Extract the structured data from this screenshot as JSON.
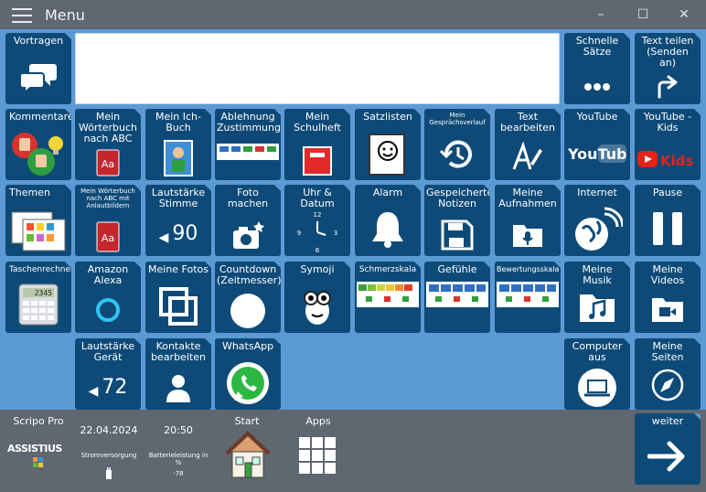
{
  "window": {
    "title": "Menu",
    "minimize": "–",
    "maximize": "☐",
    "close": "✕"
  },
  "top_row": {
    "speak": "Vortragen",
    "quick": "Schnelle\nSätze",
    "share": "Text teilen\n(Senden\nan)"
  },
  "tiles": {
    "comments": "Kommentare",
    "dict_abc": "Mein\nWörterbuch\nnach ABC",
    "my_book": "Mein Ich-\nBuch",
    "reject": "Ablehnung\nZustimmung",
    "notebook": "Mein\nSchulheft",
    "sentences": "Satzlisten",
    "history": "Mein\nGesprächsverlauf",
    "edit_text": "Text\nbearbeiten",
    "youtube": "YouTube",
    "youtube_kids": "YouTube -\nKids",
    "topics": "Themen",
    "dict_pics": "Mein Wörterbuch\nnach ABC mit\nAnlautbildern",
    "voice_vol": "Lautstärke\nStimme",
    "voice_vol_value": "90",
    "photo": "Foto\nmachen",
    "clock": "Uhr &\nDatum",
    "alarm": "Alarm",
    "notes": "Gespeicherte\nNotizen",
    "recordings": "Meine\nAufnahmen",
    "internet": "Internet",
    "pause": "Pause",
    "calculator": "Taschenrechner",
    "alexa": "Amazon\nAlexa",
    "photos": "Meine Fotos",
    "countdown": "Countdown\n(Zeitmesser)",
    "symoji": "Symoji",
    "pain": "Schmerzskala",
    "feelings": "Gefühle",
    "rating": "Bewertungsskala",
    "music": "Meine Musik",
    "videos": "Meine\nVideos",
    "device_vol": "Lautstärke\nGerät",
    "device_vol_value": "72",
    "contacts": "Kontakte\nbearbeiten",
    "whatsapp": "WhatsApp",
    "computer_off": "Computer\naus",
    "my_pages": "Meine\nSeiten",
    "youtube_logo": "YouTube",
    "kids_logo": "Kids",
    "dict_letters": "Aa",
    "calc_display": "2345"
  },
  "clock_numbers": [
    "12",
    "3",
    "6",
    "9"
  ],
  "bottom": {
    "app_name": "Scripo Pro",
    "logo_text": "ASSISTIUS",
    "date": "22.04.2024",
    "time": "20:50",
    "power_label": "Stromversorgung",
    "battery_label": "Batterieleistung in\n%",
    "battery_value": "78",
    "start": "Start",
    "apps": "Apps",
    "next": "weiter"
  },
  "colors": {
    "tile": "#0e4a78",
    "background": "#5b9ad3",
    "bar": "#5f6770"
  }
}
